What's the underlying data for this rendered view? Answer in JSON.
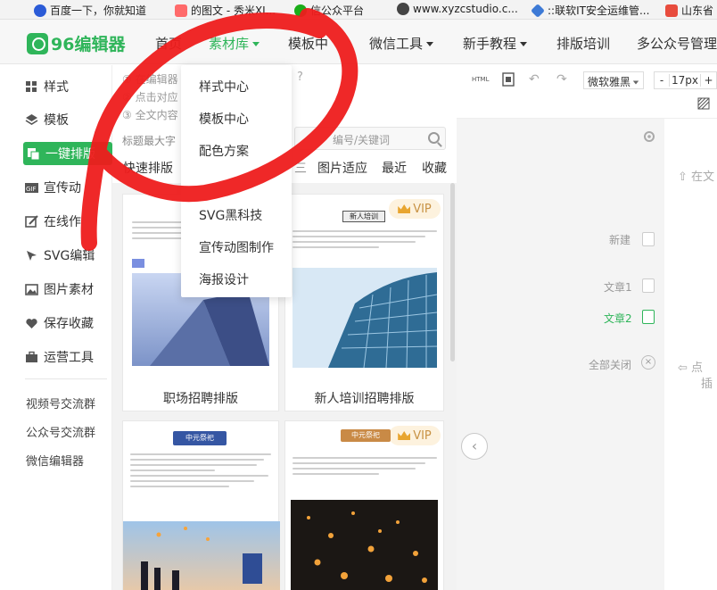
{
  "bookmarks": [
    {
      "label": "百度一下，你就知道",
      "icon": "baidu-paw-icon"
    },
    {
      "label": "的图文 - 秀米XI...",
      "icon": "xiumi-icon"
    },
    {
      "label": "信公众平台",
      "icon": "wechat-icon"
    },
    {
      "label": "www.xyzcstudio.c...",
      "icon": "globe-icon"
    },
    {
      "label": "::联软IT安全运维管...",
      "icon": "lianruan-icon"
    },
    {
      "label": "山东省",
      "icon": "shandong-icon"
    }
  ],
  "logo": {
    "text": "96编辑器"
  },
  "nav": {
    "items": [
      {
        "label": "首页"
      },
      {
        "label": "素材库"
      },
      {
        "label": "模板中"
      },
      {
        "label": "微信工具"
      },
      {
        "label": "新手教程"
      },
      {
        "label": "排版培训"
      },
      {
        "label": "多公众号管理"
      }
    ]
  },
  "sidebar": {
    "items": [
      {
        "label": "样式",
        "icon": "grid-icon"
      },
      {
        "label": "模板",
        "icon": "layers-icon"
      },
      {
        "label": "一键排版",
        "icon": "copy-icon"
      },
      {
        "label": "宣传动",
        "icon": "gif-icon"
      },
      {
        "label": "在线作",
        "icon": "edit-icon"
      },
      {
        "label": "SVG编辑",
        "icon": "cursor-icon"
      },
      {
        "label": "图片素材",
        "icon": "image-icon"
      },
      {
        "label": "保存收藏",
        "icon": "heart-icon"
      },
      {
        "label": "运营工具",
        "icon": "toolbox-icon"
      }
    ],
    "links": [
      "视频号交流群",
      "公众号交流群",
      "微信编辑器"
    ]
  },
  "panel": {
    "hints": [
      "在编辑器",
      "点击对应",
      "全文内容"
    ],
    "hint_label": "标题最大字",
    "search_placeholder": "编号/关键词",
    "tabs": [
      "快速排版",
      "图片适应",
      "最近",
      "收藏"
    ]
  },
  "dropdown": {
    "items": [
      "样式中心",
      "模板中心",
      "配色方案",
      "SVG黑科技",
      "宣传动图制作",
      "海报设计"
    ]
  },
  "cards": [
    {
      "caption": "职场招聘排版",
      "vip": false
    },
    {
      "caption": "新人培训招聘排版",
      "vip": true,
      "vip_label": "VIP",
      "tag": "新人培训"
    },
    {
      "caption": "",
      "vip": false,
      "tag": "中元祭祀"
    },
    {
      "caption": "",
      "vip": true,
      "vip_label": "VIP",
      "tag": "中元祭祀"
    }
  ],
  "toolbar": {
    "font": "微软雅黑",
    "size_minus": "-",
    "size": "17px",
    "size_plus": "+",
    "html_label": "HTML"
  },
  "right": {
    "actions": [
      {
        "label": "新建"
      },
      {
        "label": "文章1"
      },
      {
        "label": "文章2"
      },
      {
        "label": "全部关闭"
      }
    ],
    "partial_labels": [
      "在文",
      "点",
      "插"
    ]
  },
  "colors": {
    "brand": "#2fb55a",
    "ink": "#ee1c1c",
    "vip": "#c89244"
  }
}
